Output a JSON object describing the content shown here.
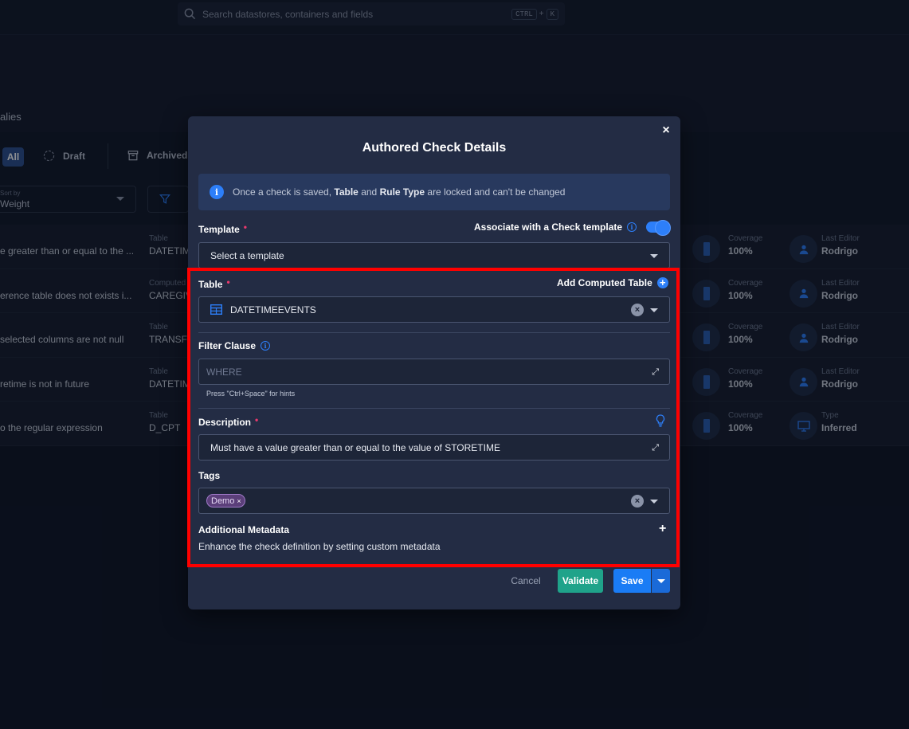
{
  "search": {
    "placeholder": "Search datastores, containers and fields",
    "kbd_ctrl": "CTRL",
    "kbd_plus": "+",
    "kbd_k": "K"
  },
  "background": {
    "crumb": "alies",
    "tabs": {
      "all": "All",
      "draft": "Draft",
      "archived": "Archived"
    },
    "sort": {
      "label": "Sort by",
      "value": "Weight"
    },
    "rows": [
      {
        "name": "e greater than or equal to the ...",
        "type_label": "Table",
        "type_value": "DATETIM",
        "cov_label": "Coverage",
        "cov_value": "100%",
        "ed_label": "Last Editor",
        "ed_value": "Rodrigo"
      },
      {
        "name": "erence table does not exists i...",
        "type_label": "Computed",
        "type_value": "CAREGIV",
        "cov_label": "Coverage",
        "cov_value": "100%",
        "ed_label": "Last Editor",
        "ed_value": "Rodrigo"
      },
      {
        "name": "selected columns are not null",
        "type_label": "Table",
        "type_value": "TRANSFE",
        "cov_label": "Coverage",
        "cov_value": "100%",
        "ed_label": "Last Editor",
        "ed_value": "Rodrigo"
      },
      {
        "name": "retime is not in future",
        "type_label": "Table",
        "type_value": "DATETIM",
        "cov_label": "Coverage",
        "cov_value": "100%",
        "ed_label": "Last Editor",
        "ed_value": "Rodrigo"
      },
      {
        "name": "o the regular expression",
        "type_label": "Table",
        "type_value": "D_CPT",
        "cov_label": "Coverage",
        "cov_value": "100%",
        "ed_label": "Type",
        "ed_value": "Inferred"
      }
    ]
  },
  "modal": {
    "title": "Authored Check Details",
    "close": "×",
    "info_pre": "Once a check is saved,",
    "info_table": "Table",
    "info_and": "and",
    "info_rule": "Rule Type",
    "info_post": "are locked and can't be changed",
    "template_label": "Template",
    "associate_label": "Associate with a Check template",
    "template_placeholder": "Select a template",
    "table_label": "Table",
    "add_computed": "Add Computed Table",
    "table_value": "DATETIMEEVENTS",
    "filter_label": "Filter Clause",
    "filter_placeholder": "WHERE",
    "filter_hint": "Press \"Ctrl+Space\" for hints",
    "description_label": "Description",
    "description_value": "Must have a value greater than or equal to the value of STORETIME",
    "tags_label": "Tags",
    "tag": "Demo",
    "metadata_label": "Additional Metadata",
    "metadata_sub": "Enhance the check definition by setting custom metadata",
    "cancel": "Cancel",
    "validate": "Validate",
    "save": "Save",
    "required_mark": "•",
    "info_glyph": "i",
    "expand_glyph": "⤢",
    "clear_glyph": "×",
    "plus_glyph": "+"
  },
  "colors": {
    "accent": "#2d7ff9",
    "validate": "#1fa38a",
    "highlight": "#ff0000",
    "required": "#e8396d"
  }
}
